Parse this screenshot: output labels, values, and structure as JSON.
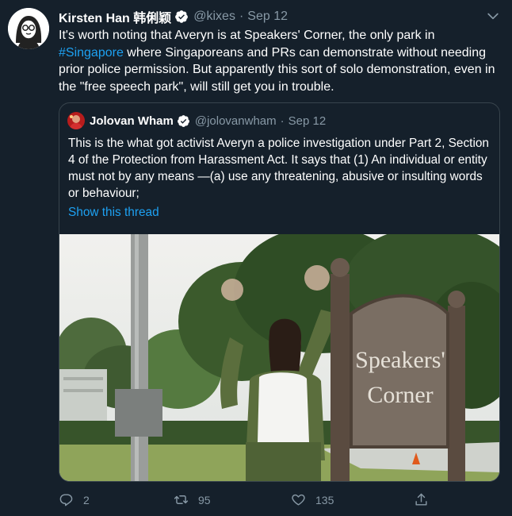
{
  "tweet": {
    "author_name": "Kirsten Han 韩俐颖",
    "handle": "@kixes",
    "separator": "·",
    "date": "Sep 12",
    "text_before": "It's worth noting that Averyn is at Speakers' Corner, the only park in ",
    "hashtag": "#Singapore",
    "text_after": " where Singaporeans and PRs can demonstrate without needing prior police permission. But apparently this sort of solo demonstration, even in the \"free speech park\", will still get you in trouble."
  },
  "quoted": {
    "author_name": "Jolovan Wham",
    "handle": "@jolovanwham",
    "separator": "·",
    "date": "Sep 12",
    "text": "This is the what got activist Averyn a police investigation under Part 2, Section 4 of the Protection from Harassment Act. It says that (1) An individual or entity must not by any means —(a) use any threatening, abusive or insulting words or behaviour;",
    "show_thread": "Show this thread",
    "photo": {
      "sign_line1": "Speakers'",
      "sign_line2": "Corner"
    }
  },
  "actions": {
    "reply_count": "2",
    "retweet_count": "95",
    "like_count": "135"
  },
  "icons": {
    "verified": "verified-badge-icon",
    "more": "chevron-down-icon",
    "reply": "reply-icon",
    "retweet": "retweet-icon",
    "like": "heart-icon",
    "share": "share-icon"
  },
  "colors": {
    "background": "#15202b",
    "accent": "#1da1f2",
    "secondary_text": "#8899a6",
    "border": "#38444d"
  }
}
